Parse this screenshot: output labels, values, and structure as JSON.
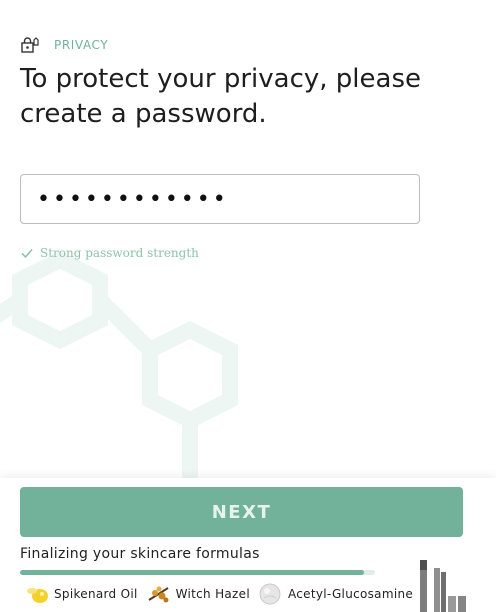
{
  "header": {
    "eyebrow_icon": "lock-house-icon",
    "eyebrow_label": "PRIVACY",
    "title": "To protect your privacy, please create a password."
  },
  "password": {
    "masked_value": "••••••••••••"
  },
  "strength": {
    "icon": "check-icon",
    "text": "Strong password strength"
  },
  "actions": {
    "next_label": "NEXT"
  },
  "progress": {
    "label": "Finalizing your skincare formulas",
    "percent": 97
  },
  "ingredients": [
    {
      "name": "Spikenard Oil",
      "icon": "oil-drop-icon"
    },
    {
      "name": "Witch Hazel",
      "icon": "witch-hazel-icon"
    },
    {
      "name": "Acetyl-Glucosamine",
      "icon": "glucosamine-icon"
    }
  ],
  "colors": {
    "accent": "#72b19a",
    "accent_light": "#8cc2ad",
    "hex_bg": "#eef6f2"
  }
}
